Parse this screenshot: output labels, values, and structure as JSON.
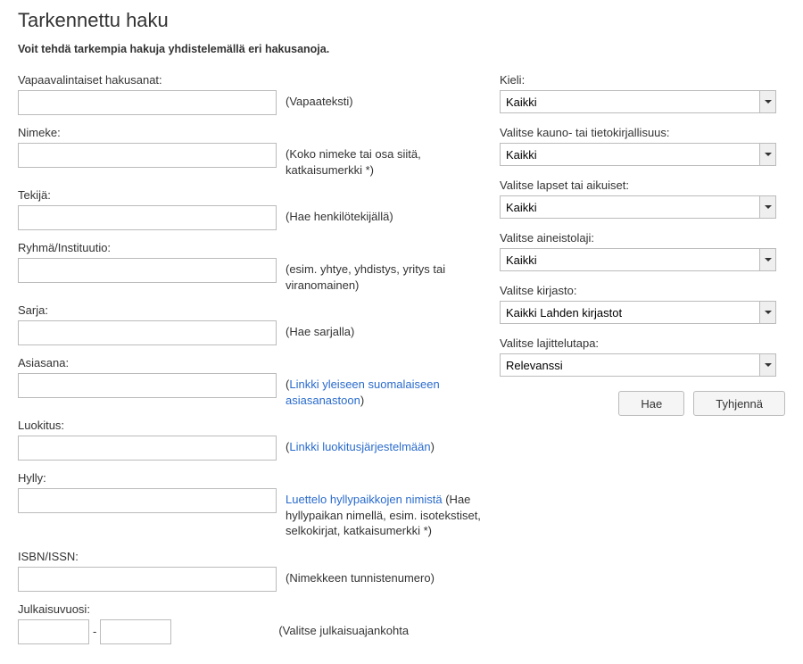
{
  "title": "Tarkennettu haku",
  "intro": "Voit tehdä tarkempia hakuja yhdistelemällä eri hakusanoja.",
  "left": {
    "freeText": {
      "label": "Vapaavalintaiset hakusanat:",
      "hint": "(Vapaateksti)"
    },
    "title": {
      "label": "Nimeke:",
      "hint": "(Koko nimeke tai osa siitä, katkaisumerkki *)"
    },
    "author": {
      "label": "Tekijä:",
      "hint": "(Hae henkilötekijällä)"
    },
    "group": {
      "label": "Ryhmä/Instituutio:",
      "hint": "(esim. yhtye, yhdistys, yritys tai viranomainen)"
    },
    "series": {
      "label": "Sarja:",
      "hint": "(Hae sarjalla)"
    },
    "subject": {
      "label": "Asiasana:",
      "hintPrefix": "(",
      "linkText": "Linkki yleiseen suomalaiseen asiasanastoon",
      "hintSuffix": ")"
    },
    "classification": {
      "label": "Luokitus:",
      "hintPrefix": "(",
      "linkText": "Linkki luokitusjärjestelmään",
      "hintSuffix": ")"
    },
    "shelf": {
      "label": "Hylly:",
      "linkText": "Luettelo hyllypaikkojen nimistä",
      "hintRest": " (Hae hyllypaikan nimellä, esim. isotekstiset, selkokirjat, katkaisumerkki *)"
    },
    "isbn": {
      "label": "ISBN/ISSN:",
      "hint": "(Nimekkeen tunnistenumero)"
    },
    "year": {
      "label": "Julkaisuvuosi:",
      "hint": "(Valitse julkaisuajankohta"
    }
  },
  "right": {
    "language": {
      "label": "Kieli:",
      "value": "Kaikki"
    },
    "fiction": {
      "label": "Valitse kauno- tai tietokirjallisuus:",
      "value": "Kaikki"
    },
    "audience": {
      "label": "Valitse lapset tai aikuiset:",
      "value": "Kaikki"
    },
    "material": {
      "label": "Valitse aineistolaji:",
      "value": "Kaikki"
    },
    "library": {
      "label": "Valitse kirjasto:",
      "value": "Kaikki Lahden kirjastot"
    },
    "sort": {
      "label": "Valitse lajittelutapa:",
      "value": "Relevanssi"
    }
  },
  "buttons": {
    "search": "Hae",
    "clear": "Tyhjennä"
  }
}
